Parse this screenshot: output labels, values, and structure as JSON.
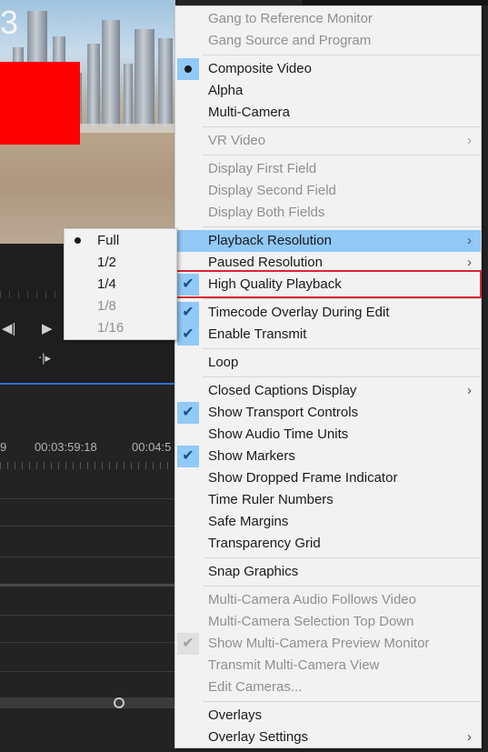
{
  "preview": {
    "overlay_number": "3"
  },
  "timeline": {
    "timecodes": [
      "9",
      "00:03:59:18",
      "00:04:5"
    ]
  },
  "menu": {
    "items": [
      {
        "label": "Gang to Reference Monitor",
        "disabled": true
      },
      {
        "label": "Gang Source and Program",
        "disabled": true
      },
      {
        "sep": true
      },
      {
        "label": "Composite Video",
        "mark": "dot"
      },
      {
        "label": "Alpha"
      },
      {
        "label": "Multi-Camera"
      },
      {
        "sep": true
      },
      {
        "label": "VR Video",
        "disabled": true,
        "submenu": true
      },
      {
        "sep": true
      },
      {
        "label": "Display First Field",
        "disabled": true
      },
      {
        "label": "Display Second Field",
        "disabled": true
      },
      {
        "label": "Display Both Fields",
        "disabled": true
      },
      {
        "sep": true
      },
      {
        "label": "Playback Resolution",
        "submenu": true,
        "highlight": true
      },
      {
        "label": "Paused Resolution",
        "submenu": true
      },
      {
        "label": "High Quality Playback",
        "mark": "check"
      },
      {
        "sep": true
      },
      {
        "label": "Timecode Overlay During Edit",
        "mark": "check"
      },
      {
        "label": "Enable Transmit",
        "mark": "check"
      },
      {
        "sep": true
      },
      {
        "label": "Loop"
      },
      {
        "sep": true
      },
      {
        "label": "Closed Captions Display",
        "submenu": true
      },
      {
        "label": "Show Transport Controls",
        "mark": "check"
      },
      {
        "label": "Show Audio Time Units"
      },
      {
        "label": "Show Markers",
        "mark": "check"
      },
      {
        "label": "Show Dropped Frame Indicator"
      },
      {
        "label": "Time Ruler Numbers"
      },
      {
        "label": "Safe Margins"
      },
      {
        "label": "Transparency Grid"
      },
      {
        "sep": true
      },
      {
        "label": "Snap Graphics"
      },
      {
        "sep": true
      },
      {
        "label": "Multi-Camera Audio Follows Video",
        "disabled": true
      },
      {
        "label": "Multi-Camera Selection Top Down",
        "disabled": true
      },
      {
        "label": "Show Multi-Camera Preview Monitor",
        "disabled": true,
        "mark": "check"
      },
      {
        "label": "Transmit Multi-Camera View",
        "disabled": true
      },
      {
        "label": "Edit Cameras...",
        "disabled": true
      },
      {
        "sep": true
      },
      {
        "label": "Overlays"
      },
      {
        "label": "Overlay Settings",
        "submenu": true
      }
    ]
  },
  "submenu": {
    "items": [
      {
        "label": "Full",
        "selected": true
      },
      {
        "label": "1/2"
      },
      {
        "label": "1/4"
      },
      {
        "label": "1/8",
        "disabled": true
      },
      {
        "label": "1/16",
        "disabled": true
      }
    ]
  },
  "colors": {
    "menu_bg": "#f2f2f2",
    "highlight": "#91c9f7",
    "callout_border": "#d62832",
    "timeline_accent": "#2d6fd6"
  }
}
